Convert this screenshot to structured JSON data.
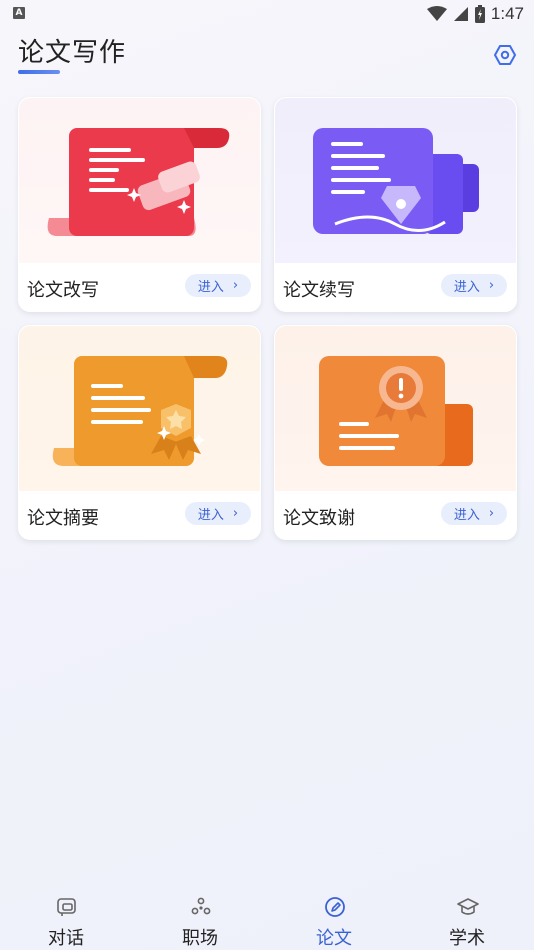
{
  "status_bar": {
    "notification_badge": "A",
    "time": "1:47"
  },
  "header": {
    "title": "论文写作",
    "settings_icon": "settings-hexagon-icon",
    "accent_color": "#3f6ee8"
  },
  "cards": [
    {
      "label": "论文改写",
      "button": "进入",
      "theme": "#e8384a",
      "icon": "rewrite-scroll-icon"
    },
    {
      "label": "论文续写",
      "button": "进入",
      "theme": "#6a4df0",
      "icon": "continue-pen-icon"
    },
    {
      "label": "论文摘要",
      "button": "进入",
      "theme": "#ee9a2c",
      "icon": "abstract-scroll-icon"
    },
    {
      "label": "论文致谢",
      "button": "进入",
      "theme": "#f08a3a",
      "icon": "acknowledgement-certificate-icon"
    }
  ],
  "bottom_nav": {
    "items": [
      {
        "label": "对话",
        "icon": "chat-icon",
        "active": false
      },
      {
        "label": "职场",
        "icon": "workplace-icon",
        "active": false
      },
      {
        "label": "论文",
        "icon": "paper-edit-icon",
        "active": true
      },
      {
        "label": "学术",
        "icon": "academic-cap-icon",
        "active": false
      }
    ],
    "active_color": "#3a62d4"
  }
}
